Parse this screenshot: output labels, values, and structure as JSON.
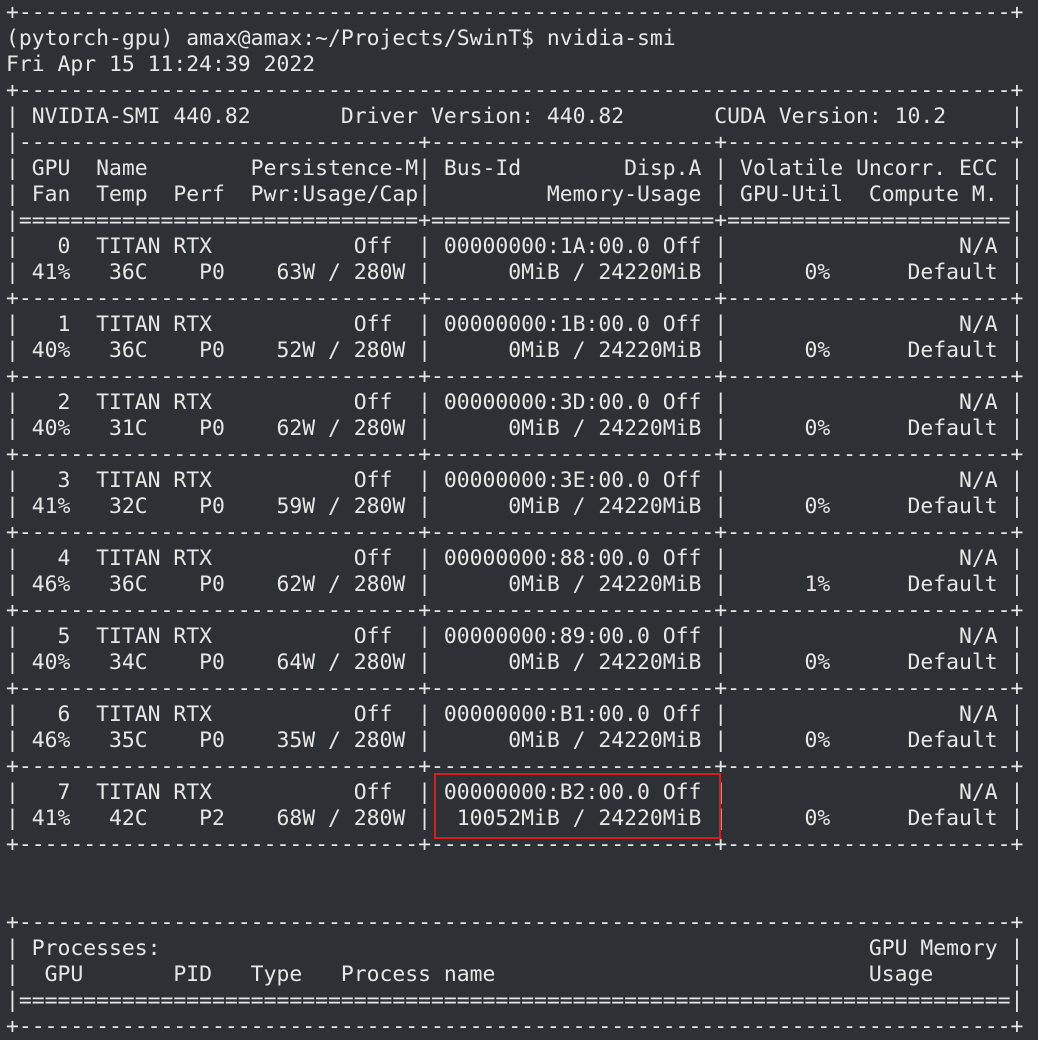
{
  "terminal": {
    "lines": [
      "+-----------------------------------------------------------------------------+",
      "(pytorch-gpu) amax@amax:~/Projects/SwinT$ nvidia-smi",
      "Fri Apr 15 11:24:39 2022",
      "+-----------------------------------------------------------------------------+",
      "| NVIDIA-SMI 440.82       Driver Version: 440.82       CUDA Version: 10.2     |",
      "|-------------------------------+----------------------+----------------------+",
      "| GPU  Name        Persistence-M| Bus-Id        Disp.A | Volatile Uncorr. ECC |",
      "| Fan  Temp  Perf  Pwr:Usage/Cap|         Memory-Usage | GPU-Util  Compute M. |",
      "|===============================+======================+======================|",
      "|   0  TITAN RTX           Off  | 00000000:1A:00.0 Off |                  N/A |",
      "| 41%   36C    P0    63W / 280W |      0MiB / 24220MiB |      0%      Default |",
      "+-------------------------------+----------------------+----------------------+",
      "|   1  TITAN RTX           Off  | 00000000:1B:00.0 Off |                  N/A |",
      "| 40%   36C    P0    52W / 280W |      0MiB / 24220MiB |      0%      Default |",
      "+-------------------------------+----------------------+----------------------+",
      "|   2  TITAN RTX           Off  | 00000000:3D:00.0 Off |                  N/A |",
      "| 40%   31C    P0    62W / 280W |      0MiB / 24220MiB |      0%      Default |",
      "+-------------------------------+----------------------+----------------------+",
      "|   3  TITAN RTX           Off  | 00000000:3E:00.0 Off |                  N/A |",
      "| 41%   32C    P0    59W / 280W |      0MiB / 24220MiB |      0%      Default |",
      "+-------------------------------+----------------------+----------------------+",
      "|   4  TITAN RTX           Off  | 00000000:88:00.0 Off |                  N/A |",
      "| 46%   36C    P0    62W / 280W |      0MiB / 24220MiB |      1%      Default |",
      "+-------------------------------+----------------------+----------------------+",
      "|   5  TITAN RTX           Off  | 00000000:89:00.0 Off |                  N/A |",
      "| 40%   34C    P0    64W / 280W |      0MiB / 24220MiB |      0%      Default |",
      "+-------------------------------+----------------------+----------------------+",
      "|   6  TITAN RTX           Off  | 00000000:B1:00.0 Off |                  N/A |",
      "| 46%   35C    P0    35W / 280W |      0MiB / 24220MiB |      0%      Default |",
      "+-------------------------------+----------------------+----------------------+",
      "|   7  TITAN RTX           Off  | 00000000:B2:00.0 Off |                  N/A |",
      "| 41%   42C    P2    68W / 280W |  10052MiB / 24220MiB |      0%      Default |",
      "+-------------------------------+----------------------+----------------------+",
      "",
      "",
      "+-----------------------------------------------------------------------------+",
      "| Processes:                                                       GPU Memory |",
      "|  GPU       PID   Type   Process name                             Usage      |",
      "|=============================================================================|",
      "+-----------------------------------------------------------------------------+"
    ]
  },
  "colors": {
    "background": "#2d3136",
    "text": "#e6e6e6",
    "highlight_border": "#d21f1f"
  }
}
